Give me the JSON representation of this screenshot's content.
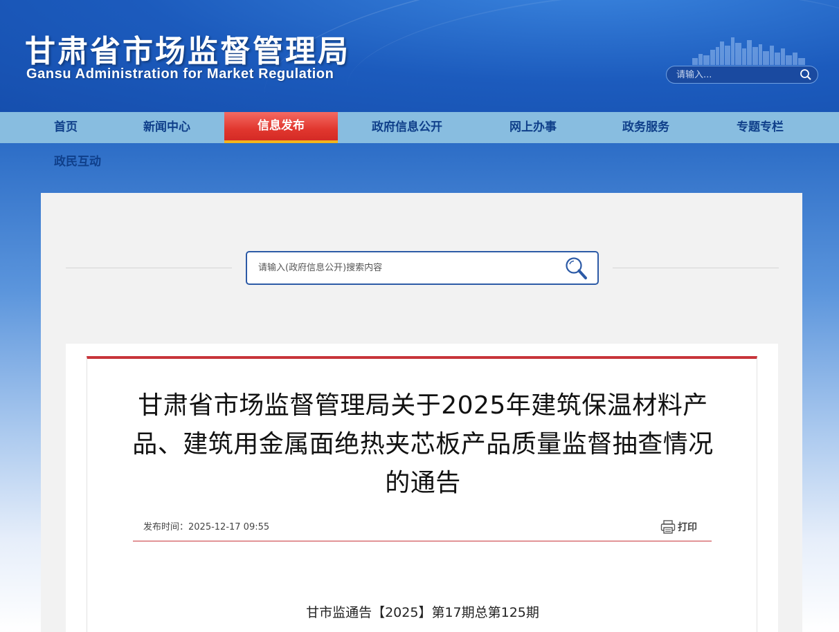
{
  "header": {
    "title_cn": "甘肃省市场监督管理局",
    "title_en": "Gansu Administration for Market Regulation",
    "search_placeholder": "请输入..."
  },
  "nav": {
    "items": [
      {
        "label": "首页",
        "active": false
      },
      {
        "label": "新闻中心",
        "active": false
      },
      {
        "label": "信息发布",
        "active": true
      },
      {
        "label": "政府信息公开",
        "active": false
      },
      {
        "label": "网上办事",
        "active": false
      },
      {
        "label": "政务服务",
        "active": false
      },
      {
        "label": "专题专栏",
        "active": false
      }
    ],
    "row2": [
      {
        "label": "政民互动"
      }
    ]
  },
  "search": {
    "placeholder": "请输入(政府信息公开)搜索内容"
  },
  "article": {
    "title": "甘肃省市场监督管理局关于2025年建筑保温材料产品、建筑用金属面绝热夹芯板产品质量监督抽查情况的通告",
    "publish_time": "发布时间：2025-12-17 09:55",
    "print_label": "打印",
    "doc_number": "甘市监通告【2025】第17期总第125期"
  },
  "colors": {
    "brand_blue": "#1c5bbd",
    "nav_bg": "#88bde0",
    "nav_active": "#e1372f",
    "accent_red": "#c8353a"
  }
}
